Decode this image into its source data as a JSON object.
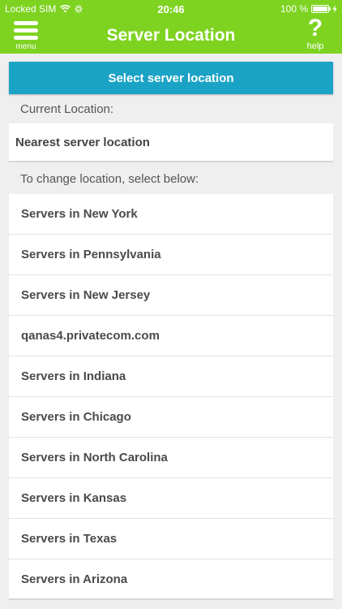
{
  "status_bar": {
    "carrier": "Locked SIM",
    "time": "20:46",
    "battery_text": "100 %",
    "battery_level": 1.0
  },
  "header": {
    "title": "Server Location",
    "menu_label": "menu",
    "help_symbol": "?",
    "help_label": "help",
    "background_color": "#7ed321"
  },
  "select_button": {
    "label": "Select server location",
    "color": "#1ba3c6"
  },
  "current": {
    "heading": "Current Location:",
    "value": "Nearest server location"
  },
  "change_heading": "To change location, select below:",
  "servers": [
    "Servers in New York",
    "Servers in Pennsylvania",
    "Servers in New Jersey",
    "qanas4.privatecom.com",
    "Servers in Indiana",
    "Servers in Chicago",
    "Servers in North Carolina",
    "Servers in Kansas",
    "Servers in Texas",
    "Servers in Arizona"
  ]
}
